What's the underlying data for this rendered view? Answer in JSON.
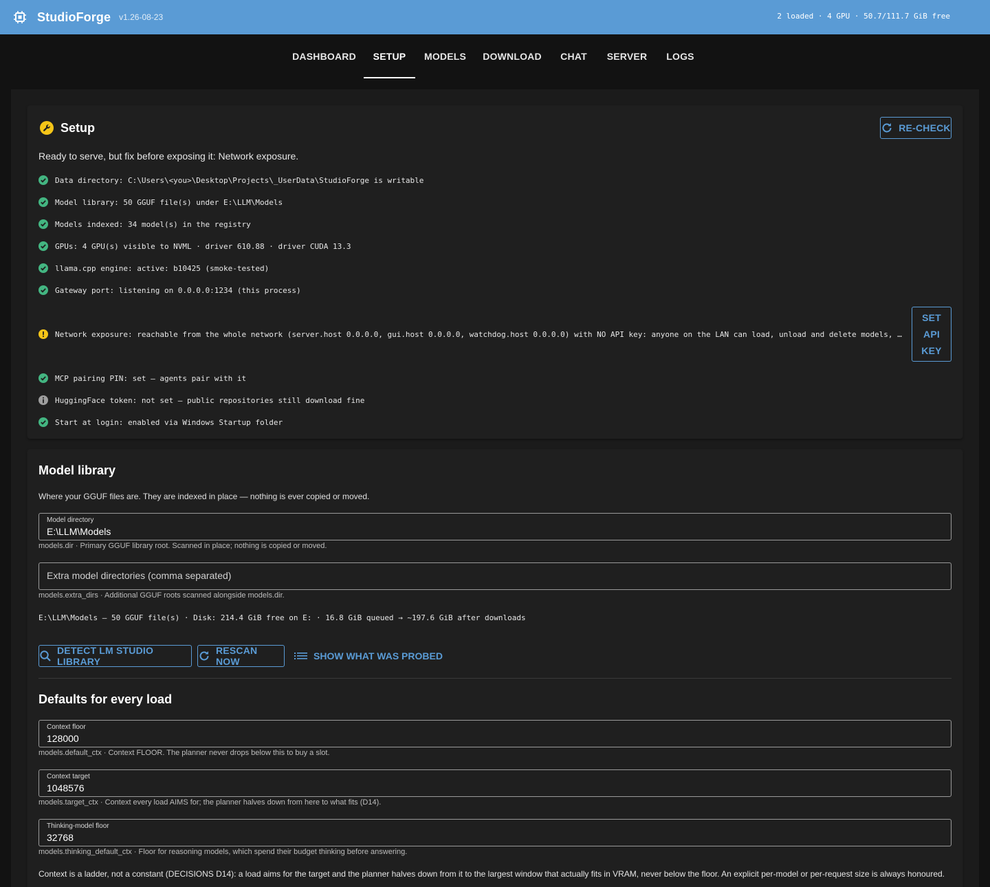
{
  "appbar": {
    "brand": "StudioForge",
    "version": "v1.26-08-23",
    "status": "2 loaded · 4 GPU · 50.7/111.7 GiB free",
    "logo_icon": "chip-icon"
  },
  "nav": {
    "tabs": [
      {
        "label": "DASHBOARD",
        "active": false
      },
      {
        "label": "SETUP",
        "active": true
      },
      {
        "label": "MODELS",
        "active": false
      },
      {
        "label": "DOWNLOAD",
        "active": false
      },
      {
        "label": "CHAT",
        "active": false
      },
      {
        "label": "SERVER",
        "active": false
      },
      {
        "label": "LOGS",
        "active": false
      }
    ]
  },
  "setup": {
    "title": "Setup",
    "icon": "wrench-icon",
    "recheck_label": "RE-CHECK",
    "summary": "Ready to serve, but fix before exposing it: Network exposure.",
    "checks": [
      {
        "status": "ok",
        "text": "Data directory: C:\\Users\\<you>\\Desktop\\Projects\\_UserData\\StudioForge is writable"
      },
      {
        "status": "ok",
        "text": "Model library: 50 GGUF file(s) under E:\\LLM\\Models"
      },
      {
        "status": "ok",
        "text": "Models indexed: 34 model(s) in the registry"
      },
      {
        "status": "ok",
        "text": "GPUs: 4 GPU(s) visible to NVML · driver 610.88 · driver CUDA 13.3"
      },
      {
        "status": "ok",
        "text": "llama.cpp engine: active: b10425 (smoke-tested)"
      },
      {
        "status": "ok",
        "text": "Gateway port: listening on 0.0.0.0:1234 (this process)"
      },
      {
        "status": "warn",
        "text": "Network exposure: reachable from the whole network (server.host 0.0.0.0, gui.host 0.0.0.0, watchdog.host 0.0.0.0) with NO API key: anyone on the LAN can load, unload and delete models, change settings and read your chats"
      },
      {
        "status": "ok",
        "text": "MCP pairing PIN: set — agents pair with it"
      },
      {
        "status": "info",
        "text": "HuggingFace token: not set — public repositories still download fine"
      },
      {
        "status": "ok",
        "text": "Start at login: enabled via Windows Startup folder"
      }
    ],
    "set_api_key_label": [
      "SET",
      "API",
      "KEY"
    ],
    "colors": {
      "ok": "#43b581",
      "warn": "#f5c518",
      "info": "#9e9e9e",
      "accent": "#5a9bd5"
    }
  },
  "library": {
    "title": "Model library",
    "desc": "Where your GGUF files are. They are indexed in place — nothing is ever copied or moved.",
    "model_dir": {
      "label": "Model directory",
      "value": "E:\\LLM\\Models",
      "hint": "models.dir · Primary GGUF library root. Scanned in place; nothing is copied or moved."
    },
    "extra_dirs": {
      "placeholder": "Extra model directories (comma separated)",
      "hint": "models.extra_dirs · Additional GGUF roots scanned alongside models.dir."
    },
    "disk_line": "E:\\LLM\\Models — 50 GGUF file(s) · Disk: 214.4 GiB free on E: · 16.8 GiB queued → ~197.6 GiB after downloads",
    "buttons": {
      "detect": "DETECT LM STUDIO LIBRARY",
      "rescan": "RESCAN NOW",
      "probed": "SHOW WHAT WAS PROBED"
    }
  },
  "defaults": {
    "title": "Defaults for every load",
    "fields": [
      {
        "label": "Context floor",
        "value": "128000",
        "hint": "models.default_ctx · Context FLOOR. The planner never drops below this to buy a slot."
      },
      {
        "label": "Context target",
        "value": "1048576",
        "hint": "models.target_ctx · Context every load AIMS for; the planner halves down from here to what fits (D14)."
      },
      {
        "label": "Thinking-model floor",
        "value": "32768",
        "hint": "models.thinking_default_ctx · Floor for reasoning models, which spend their budget thinking before answering."
      }
    ],
    "note": "Context is a ladder, not a constant (DECISIONS D14): a load aims for the target and the planner halves down from it to the largest window that actually fits in VRAM, never below the floor. An explicit per-model or per-request size is always honoured."
  }
}
